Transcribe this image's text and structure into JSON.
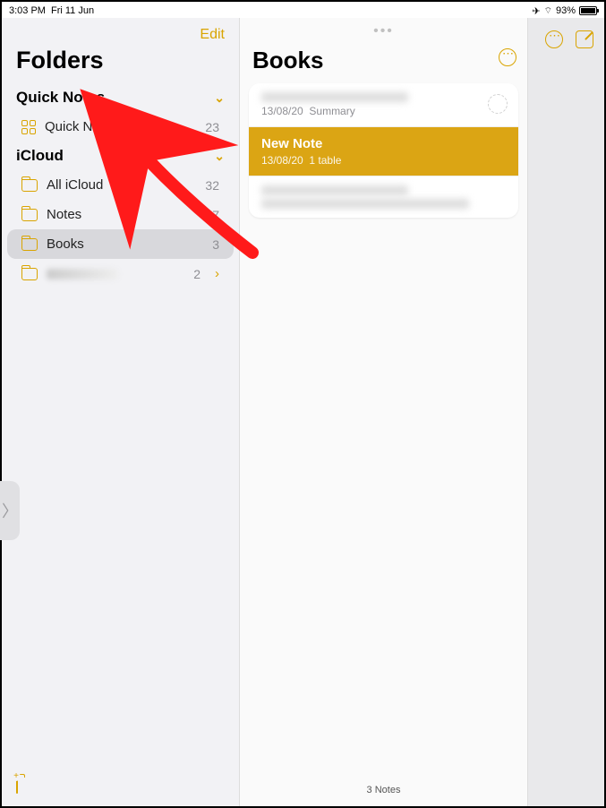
{
  "status": {
    "time": "3:03 PM",
    "date": "Fri 11 Jun",
    "battery_pct": "93%"
  },
  "sidebar": {
    "edit_label": "Edit",
    "title": "Folders",
    "sections": [
      {
        "label": "Quick Notes",
        "items": [
          {
            "label": "Quick Notes",
            "count": "23"
          }
        ]
      },
      {
        "label": "iCloud",
        "items": [
          {
            "label": "All iCloud",
            "count": "32"
          },
          {
            "label": "Notes",
            "count": "27"
          },
          {
            "label": "Books",
            "count": "3",
            "selected": true
          },
          {
            "label": "",
            "count": "2",
            "redacted": true,
            "disclosure": true
          }
        ]
      }
    ]
  },
  "main": {
    "title": "Books",
    "notes": [
      {
        "title": "",
        "date": "13/08/20",
        "subtitle": "Summary",
        "redacted_title": true,
        "sync": true
      },
      {
        "title": "New Note",
        "date": "13/08/20",
        "subtitle": "1 table",
        "selected": true
      },
      {
        "title": "",
        "date": "",
        "subtitle": "",
        "redacted_title": true,
        "redacted_sub": true
      }
    ],
    "footer": "3 Notes"
  }
}
